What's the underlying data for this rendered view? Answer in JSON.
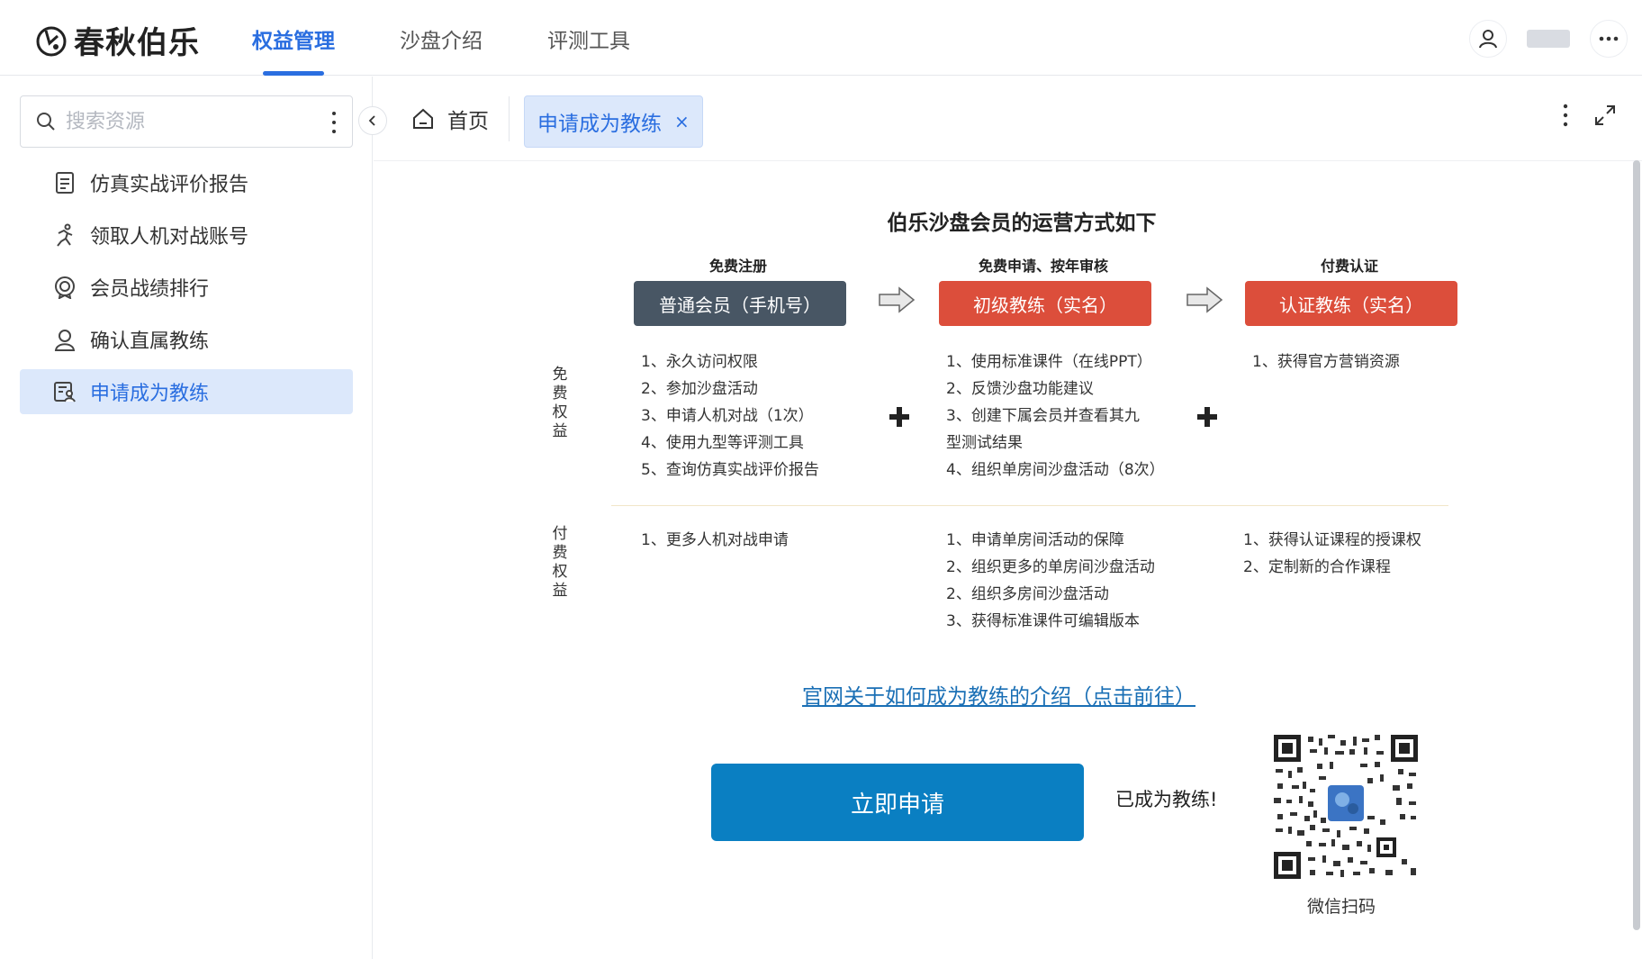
{
  "header": {
    "logo_text": "春秋伯乐",
    "nav": [
      {
        "label": "权益管理",
        "active": true
      },
      {
        "label": "沙盘介绍",
        "active": false
      },
      {
        "label": "评测工具",
        "active": false
      }
    ]
  },
  "sidebar": {
    "search_placeholder": "搜索资源",
    "items": [
      {
        "label": "仿真实战评价报告",
        "icon": "document-icon",
        "active": false
      },
      {
        "label": "领取人机对战账号",
        "icon": "running-person-icon",
        "active": false
      },
      {
        "label": "会员战绩排行",
        "icon": "award-badge-icon",
        "active": false
      },
      {
        "label": "确认直属教练",
        "icon": "user-outline-icon",
        "active": false
      },
      {
        "label": "申请成为教练",
        "icon": "application-form-icon",
        "active": true
      }
    ]
  },
  "tabs": {
    "home_label": "首页",
    "active_label": "申请成为教练",
    "close_symbol": "×"
  },
  "main": {
    "title": "伯乐沙盘会员的运营方式如下",
    "stages": [
      {
        "header": "免费注册",
        "box": "普通会员（手机号）",
        "color": "#485664"
      },
      {
        "header": "免费申请、按年审核",
        "box": "初级教练（实名）",
        "color": "#dc4e3b"
      },
      {
        "header": "付费认证",
        "box": "认证教练（实名）",
        "color": "#dc4e3b"
      }
    ],
    "free_label": "免费权益",
    "paid_label": "付费权益",
    "free_benefits": [
      [
        "1、永久访问权限",
        "2、参加沙盘活动",
        "3、申请人机对战（1次）",
        "4、使用九型等评测工具",
        "5、查询仿真实战评价报告"
      ],
      [
        "1、使用标准课件（在线PPT）",
        "2、反馈沙盘功能建议",
        "3、创建下属会员并查看其九",
        "型测试结果",
        "4、组织单房间沙盘活动（8次）"
      ],
      [
        "1、获得官方营销资源"
      ]
    ],
    "paid_benefits": [
      [
        "1、更多人机对战申请"
      ],
      [
        "1、申请单房间活动的保障",
        "2、组织更多的单房间沙盘活动",
        "2、组织多房间沙盘活动",
        "3、获得标准课件可编辑版本"
      ],
      [
        "1、获得认证课程的授课权",
        "2、定制新的合作课程"
      ]
    ],
    "intro_link": "官网关于如何成为教练的介绍（点击前往）",
    "apply_button": "立即申请",
    "already_text": "已成为教练!",
    "qr_label": "微信扫码"
  }
}
